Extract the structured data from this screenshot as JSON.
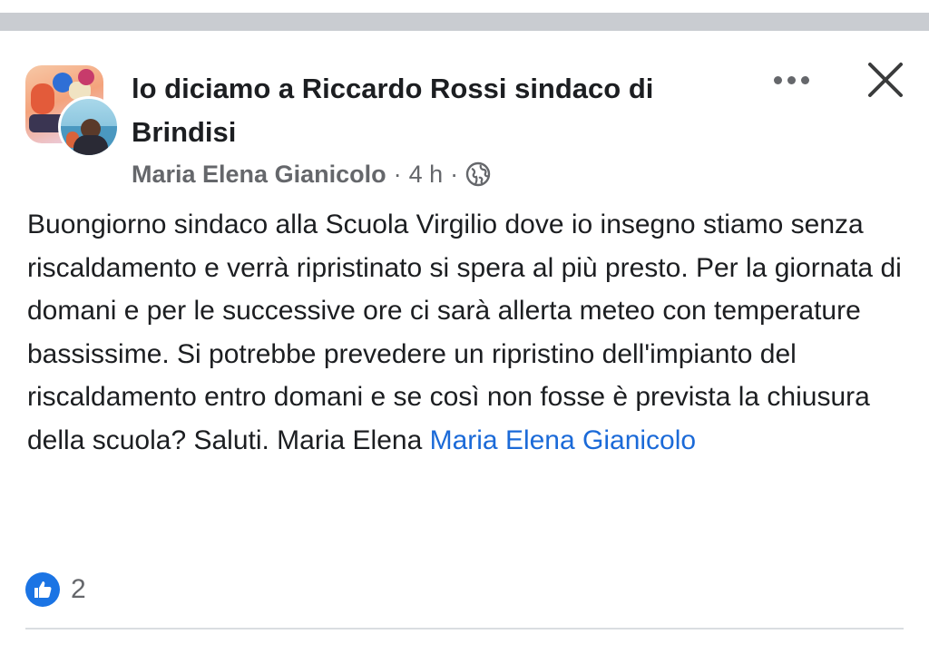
{
  "post": {
    "title": "lo diciamo a Riccardo Rossi sindaco di Brindisi",
    "author": "Maria Elena Gianicolo",
    "separator": "·",
    "timestamp": "4 h",
    "audience_icon": "globe-icon",
    "body_text": "Buongiorno sindaco alla Scuola Virgilio dove io insegno stiamo senza riscaldamento e verrà ripristinato si spera al più presto. Per la giornata di domani e per le successive ore ci sarà allerta meteo con temperature bassissime. Si potrebbe prevedere un ripristino dell'impianto del riscaldamento entro domani e se così non fosse è prevista la chiusura della scuola? Saluti. Maria Elena",
    "mention": "Maria Elena Gianicolo",
    "reaction_icon": "like-icon",
    "reaction_count": "2"
  },
  "header": {
    "more_icon": "more-horizontal-icon",
    "close_icon": "close-icon"
  },
  "colors": {
    "accent_blue": "#1b74e4",
    "mention_blue": "#1b6ad8",
    "secondary_text": "#65676b",
    "primary_text": "#1c1e21"
  }
}
